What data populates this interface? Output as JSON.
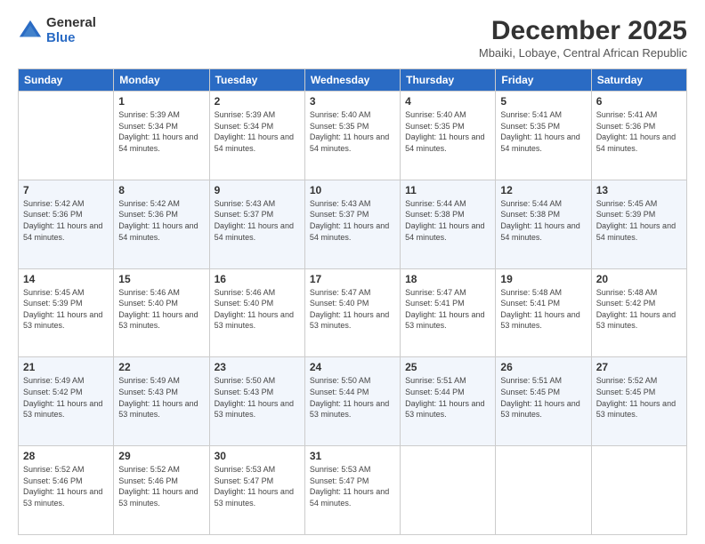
{
  "logo": {
    "general": "General",
    "blue": "Blue"
  },
  "title": "December 2025",
  "location": "Mbaiki, Lobaye, Central African Republic",
  "weekdays": [
    "Sunday",
    "Monday",
    "Tuesday",
    "Wednesday",
    "Thursday",
    "Friday",
    "Saturday"
  ],
  "weeks": [
    [
      {
        "day": "",
        "sunrise": "",
        "sunset": "",
        "daylight": ""
      },
      {
        "day": "1",
        "sunrise": "Sunrise: 5:39 AM",
        "sunset": "Sunset: 5:34 PM",
        "daylight": "Daylight: 11 hours and 54 minutes."
      },
      {
        "day": "2",
        "sunrise": "Sunrise: 5:39 AM",
        "sunset": "Sunset: 5:34 PM",
        "daylight": "Daylight: 11 hours and 54 minutes."
      },
      {
        "day": "3",
        "sunrise": "Sunrise: 5:40 AM",
        "sunset": "Sunset: 5:35 PM",
        "daylight": "Daylight: 11 hours and 54 minutes."
      },
      {
        "day": "4",
        "sunrise": "Sunrise: 5:40 AM",
        "sunset": "Sunset: 5:35 PM",
        "daylight": "Daylight: 11 hours and 54 minutes."
      },
      {
        "day": "5",
        "sunrise": "Sunrise: 5:41 AM",
        "sunset": "Sunset: 5:35 PM",
        "daylight": "Daylight: 11 hours and 54 minutes."
      },
      {
        "day": "6",
        "sunrise": "Sunrise: 5:41 AM",
        "sunset": "Sunset: 5:36 PM",
        "daylight": "Daylight: 11 hours and 54 minutes."
      }
    ],
    [
      {
        "day": "7",
        "sunrise": "Sunrise: 5:42 AM",
        "sunset": "Sunset: 5:36 PM",
        "daylight": "Daylight: 11 hours and 54 minutes."
      },
      {
        "day": "8",
        "sunrise": "Sunrise: 5:42 AM",
        "sunset": "Sunset: 5:36 PM",
        "daylight": "Daylight: 11 hours and 54 minutes."
      },
      {
        "day": "9",
        "sunrise": "Sunrise: 5:43 AM",
        "sunset": "Sunset: 5:37 PM",
        "daylight": "Daylight: 11 hours and 54 minutes."
      },
      {
        "day": "10",
        "sunrise": "Sunrise: 5:43 AM",
        "sunset": "Sunset: 5:37 PM",
        "daylight": "Daylight: 11 hours and 54 minutes."
      },
      {
        "day": "11",
        "sunrise": "Sunrise: 5:44 AM",
        "sunset": "Sunset: 5:38 PM",
        "daylight": "Daylight: 11 hours and 54 minutes."
      },
      {
        "day": "12",
        "sunrise": "Sunrise: 5:44 AM",
        "sunset": "Sunset: 5:38 PM",
        "daylight": "Daylight: 11 hours and 54 minutes."
      },
      {
        "day": "13",
        "sunrise": "Sunrise: 5:45 AM",
        "sunset": "Sunset: 5:39 PM",
        "daylight": "Daylight: 11 hours and 54 minutes."
      }
    ],
    [
      {
        "day": "14",
        "sunrise": "Sunrise: 5:45 AM",
        "sunset": "Sunset: 5:39 PM",
        "daylight": "Daylight: 11 hours and 53 minutes."
      },
      {
        "day": "15",
        "sunrise": "Sunrise: 5:46 AM",
        "sunset": "Sunset: 5:40 PM",
        "daylight": "Daylight: 11 hours and 53 minutes."
      },
      {
        "day": "16",
        "sunrise": "Sunrise: 5:46 AM",
        "sunset": "Sunset: 5:40 PM",
        "daylight": "Daylight: 11 hours and 53 minutes."
      },
      {
        "day": "17",
        "sunrise": "Sunrise: 5:47 AM",
        "sunset": "Sunset: 5:40 PM",
        "daylight": "Daylight: 11 hours and 53 minutes."
      },
      {
        "day": "18",
        "sunrise": "Sunrise: 5:47 AM",
        "sunset": "Sunset: 5:41 PM",
        "daylight": "Daylight: 11 hours and 53 minutes."
      },
      {
        "day": "19",
        "sunrise": "Sunrise: 5:48 AM",
        "sunset": "Sunset: 5:41 PM",
        "daylight": "Daylight: 11 hours and 53 minutes."
      },
      {
        "day": "20",
        "sunrise": "Sunrise: 5:48 AM",
        "sunset": "Sunset: 5:42 PM",
        "daylight": "Daylight: 11 hours and 53 minutes."
      }
    ],
    [
      {
        "day": "21",
        "sunrise": "Sunrise: 5:49 AM",
        "sunset": "Sunset: 5:42 PM",
        "daylight": "Daylight: 11 hours and 53 minutes."
      },
      {
        "day": "22",
        "sunrise": "Sunrise: 5:49 AM",
        "sunset": "Sunset: 5:43 PM",
        "daylight": "Daylight: 11 hours and 53 minutes."
      },
      {
        "day": "23",
        "sunrise": "Sunrise: 5:50 AM",
        "sunset": "Sunset: 5:43 PM",
        "daylight": "Daylight: 11 hours and 53 minutes."
      },
      {
        "day": "24",
        "sunrise": "Sunrise: 5:50 AM",
        "sunset": "Sunset: 5:44 PM",
        "daylight": "Daylight: 11 hours and 53 minutes."
      },
      {
        "day": "25",
        "sunrise": "Sunrise: 5:51 AM",
        "sunset": "Sunset: 5:44 PM",
        "daylight": "Daylight: 11 hours and 53 minutes."
      },
      {
        "day": "26",
        "sunrise": "Sunrise: 5:51 AM",
        "sunset": "Sunset: 5:45 PM",
        "daylight": "Daylight: 11 hours and 53 minutes."
      },
      {
        "day": "27",
        "sunrise": "Sunrise: 5:52 AM",
        "sunset": "Sunset: 5:45 PM",
        "daylight": "Daylight: 11 hours and 53 minutes."
      }
    ],
    [
      {
        "day": "28",
        "sunrise": "Sunrise: 5:52 AM",
        "sunset": "Sunset: 5:46 PM",
        "daylight": "Daylight: 11 hours and 53 minutes."
      },
      {
        "day": "29",
        "sunrise": "Sunrise: 5:52 AM",
        "sunset": "Sunset: 5:46 PM",
        "daylight": "Daylight: 11 hours and 53 minutes."
      },
      {
        "day": "30",
        "sunrise": "Sunrise: 5:53 AM",
        "sunset": "Sunset: 5:47 PM",
        "daylight": "Daylight: 11 hours and 53 minutes."
      },
      {
        "day": "31",
        "sunrise": "Sunrise: 5:53 AM",
        "sunset": "Sunset: 5:47 PM",
        "daylight": "Daylight: 11 hours and 54 minutes."
      },
      {
        "day": "",
        "sunrise": "",
        "sunset": "",
        "daylight": ""
      },
      {
        "day": "",
        "sunrise": "",
        "sunset": "",
        "daylight": ""
      },
      {
        "day": "",
        "sunrise": "",
        "sunset": "",
        "daylight": ""
      }
    ]
  ]
}
